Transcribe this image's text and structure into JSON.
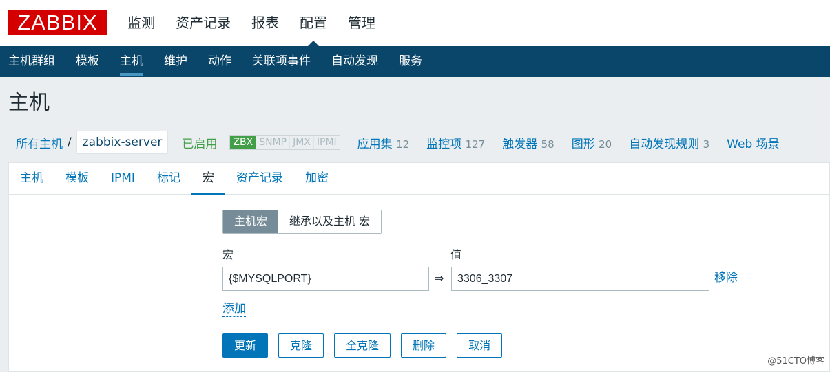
{
  "logo": "ZABBIX",
  "top_menu": [
    "监测",
    "资产记录",
    "报表",
    "配置",
    "管理"
  ],
  "sub_menu": [
    "主机群组",
    "模板",
    "主机",
    "维护",
    "动作",
    "关联项事件",
    "自动发现",
    "服务"
  ],
  "page_title": "主机",
  "breadcrumb": {
    "all_hosts": "所有主机",
    "separator": "/",
    "current": "zabbix-server",
    "status": "已启用"
  },
  "availability": [
    "ZBX",
    "SNMP",
    "JMX",
    "IPMI"
  ],
  "host_links": [
    {
      "label": "应用集",
      "count": "12"
    },
    {
      "label": "监控项",
      "count": "127"
    },
    {
      "label": "触发器",
      "count": "58"
    },
    {
      "label": "图形",
      "count": "20"
    },
    {
      "label": "自动发现规则",
      "count": "3"
    },
    {
      "label": "Web 场景",
      "count": ""
    }
  ],
  "tabs": [
    "主机",
    "模板",
    "IPMI",
    "标记",
    "宏",
    "资产记录",
    "加密"
  ],
  "macro_switch": [
    "主机宏",
    "继承以及主机 宏"
  ],
  "labels": {
    "macro": "宏",
    "value": "值"
  },
  "macro_row": {
    "macro": "{$MYSQLPORT}",
    "value": "3306_3307",
    "arrow": "⇒",
    "remove": "移除"
  },
  "add_label": "添加",
  "buttons": [
    "更新",
    "克隆",
    "全克隆",
    "删除",
    "取消"
  ],
  "watermark": "@51CTO博客",
  "colors": {
    "brand": "#d40000",
    "nav": "#0a466a",
    "link": "#0275b8",
    "enabled": "#429e47"
  }
}
